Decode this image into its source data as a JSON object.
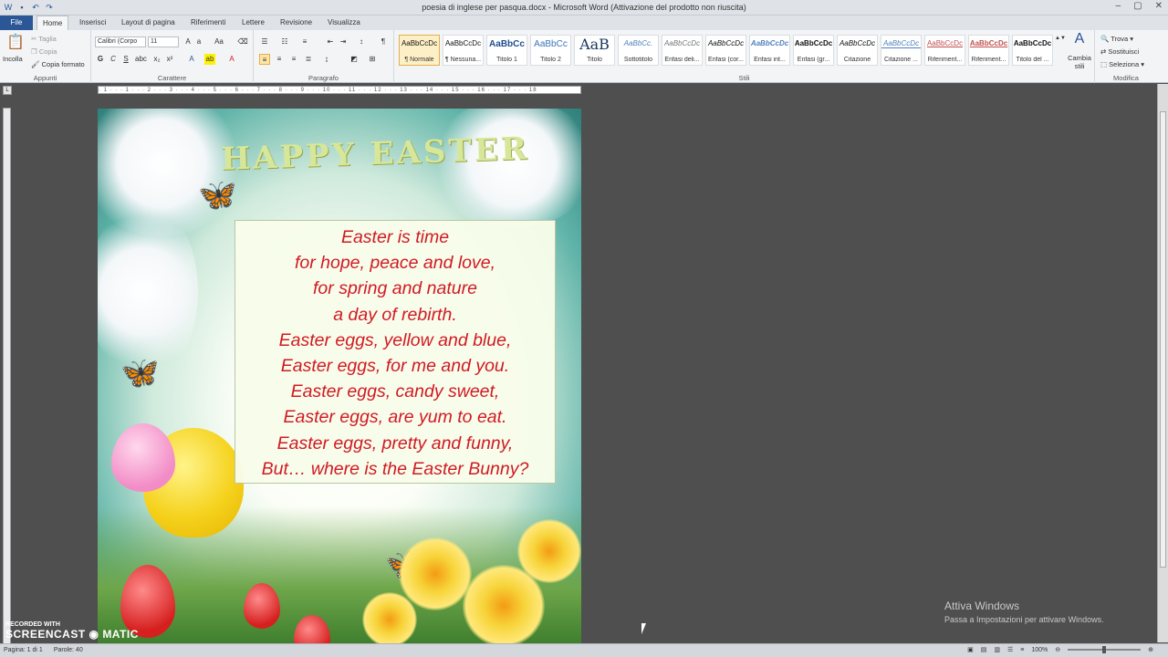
{
  "window": {
    "title": "poesia di inglese per pasqua.docx - Microsoft Word (Attivazione del prodotto non riuscita)",
    "minimize": "–",
    "maximize": "▢",
    "close": "✕"
  },
  "tabs": [
    "File",
    "Home",
    "Inserisci",
    "Layout di pagina",
    "Riferimenti",
    "Lettere",
    "Revisione",
    "Visualizza"
  ],
  "ribbon": {
    "clipboard": {
      "paste": "Incolla",
      "cut": "Taglia",
      "copy": "Copia",
      "format_painter": "Copia formato",
      "group": "Appunti"
    },
    "font": {
      "font_name": "Calibri (Corpo",
      "font_size": "11",
      "bold": "G",
      "italic": "C",
      "underline": "S",
      "group": "Carattere"
    },
    "paragraph": {
      "group": "Paragrafo"
    },
    "styles": {
      "items": [
        {
          "sample": "AaBbCcDc",
          "name": "¶ Normale"
        },
        {
          "sample": "AaBbCcDc",
          "name": "¶ Nessuna..."
        },
        {
          "sample": "AaBbCc",
          "name": "Titolo 1"
        },
        {
          "sample": "AaBbCc",
          "name": "Titolo 2"
        },
        {
          "sample": "AaB",
          "name": "Titolo"
        },
        {
          "sample": "AaBbCc.",
          "name": "Sottotitolo"
        },
        {
          "sample": "AaBbCcDc",
          "name": "Enfasi deli..."
        },
        {
          "sample": "AaBbCcDc",
          "name": "Enfasi (cor..."
        },
        {
          "sample": "AaBbCcDc",
          "name": "Enfasi int..."
        },
        {
          "sample": "AaBbCcDc",
          "name": "Enfasi (gr..."
        },
        {
          "sample": "AaBbCcDc",
          "name": "Citazione"
        },
        {
          "sample": "AaBbCcDc",
          "name": "Citazione ..."
        },
        {
          "sample": "AaBbCcDc",
          "name": "Riferiment..."
        },
        {
          "sample": "AaBbCcDc",
          "name": "Riferiment..."
        },
        {
          "sample": "AaBbCcDc",
          "name": "Titolo del ..."
        }
      ],
      "change_styles": "Cambia stili",
      "group": "Stili"
    },
    "editing": {
      "find": "Trova",
      "replace": "Sostituisci",
      "select": "Seleziona",
      "group": "Modifica"
    }
  },
  "ruler_text": "· 1 · · · 1 · · · 2 · · · 3 · · · 4 · · · 5 · · · 6 · · · 7 · · · 8 · · · 9 · · · 10 · · · 11 · · · 12 · · · 13 · · · 14 · · · 15 · · · 16 · · · 17 · · · 18",
  "document": {
    "headline": "HAPPY EASTER",
    "poem_lines": [
      "Easter is time",
      "for hope, peace and love,",
      "for spring and nature",
      "a day of rebirth.",
      "Easter eggs, yellow and blue,",
      "Easter eggs, for me and you.",
      "Easter eggs, candy sweet,",
      "Easter eggs, are yum to eat.",
      "Easter eggs, pretty and funny,",
      "But… where is the Easter Bunny?"
    ]
  },
  "statusbar": {
    "page": "Pagina: 1 di 1",
    "words": "Parole: 40",
    "zoom": "100%"
  },
  "activation": {
    "title": "Attiva Windows",
    "subtitle": "Passa a Impostazioni per attivare Windows."
  },
  "watermark": {
    "line1": "RECORDED WITH",
    "line2": "SCREENCAST ◉ MATIC"
  }
}
